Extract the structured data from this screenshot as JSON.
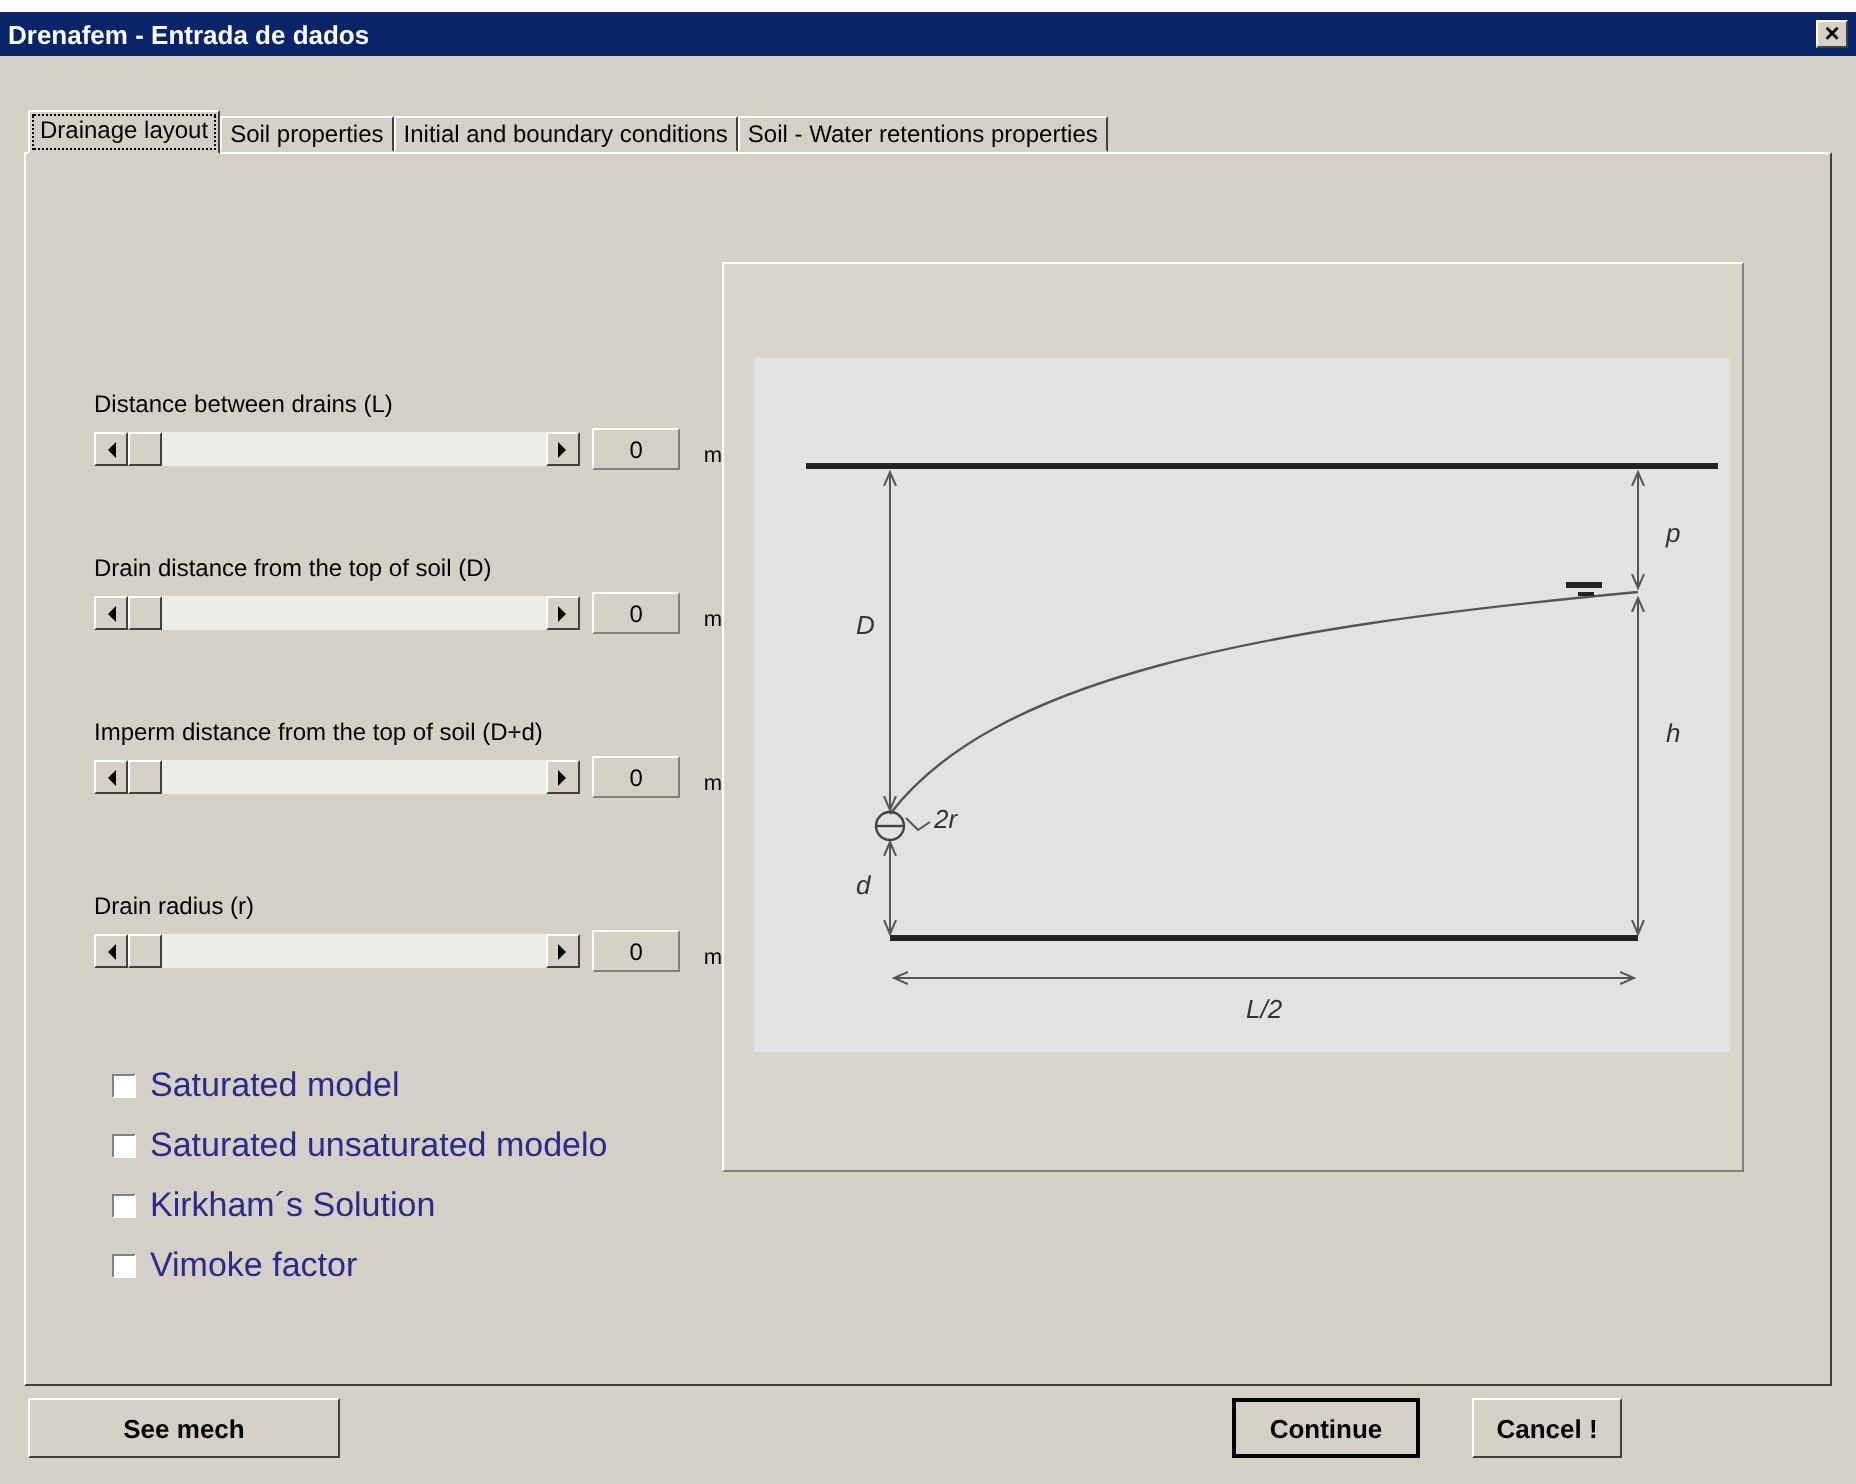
{
  "window": {
    "title": "Drenafem - Entrada de dados",
    "close_label": "×"
  },
  "tabs": [
    {
      "label": "Drainage layout",
      "selected": true
    },
    {
      "label": "Soil properties",
      "selected": false
    },
    {
      "label": "Initial and boundary conditions",
      "selected": false
    },
    {
      "label": "Soil - Water retentions properties",
      "selected": false
    }
  ],
  "sliders": [
    {
      "label": "Distance between drains (L)",
      "level": 0,
      "value": "0",
      "unit": "m"
    },
    {
      "label": "Drain distance from the top of soil (D)",
      "level": 0,
      "value": "0",
      "unit": "m"
    },
    {
      "label": "Imperm distance from the top of soil (D+d)",
      "level": 0,
      "value": "0",
      "unit": "m"
    },
    {
      "label": "Drain radius (r)",
      "level": 0,
      "value": "0",
      "unit": "m"
    }
  ],
  "checkboxes": [
    {
      "label": "Saturated model",
      "checked": false
    },
    {
      "label": "Saturated unsaturated modelo",
      "checked": false
    },
    {
      "label": "Kirkham´s Solution",
      "checked": false
    },
    {
      "label": "Vimoke factor",
      "checked": false
    }
  ],
  "diagram": {
    "labels": [
      "D",
      "p",
      "h",
      "d",
      "2r",
      "L/2"
    ]
  },
  "buttons": [
    "See mech",
    "Continue",
    "Cancel !"
  ]
}
